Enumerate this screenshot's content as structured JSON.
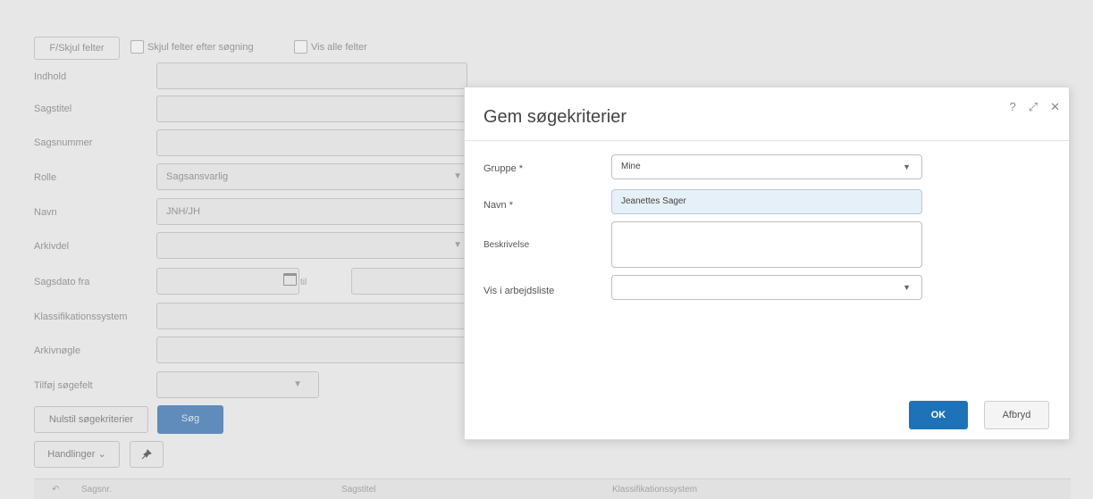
{
  "toolbar": {
    "hide_fields_button": "F/Skjul felter",
    "hide_after_search_label": "Skjul felter efter søgning",
    "show_all_label": "Vis alle felter"
  },
  "form": {
    "rows": [
      {
        "label": "Indhold",
        "value": ""
      },
      {
        "label": "Sagstitel",
        "value": ""
      },
      {
        "label": "Sagsnummer",
        "value": ""
      },
      {
        "label": "Rolle",
        "value": "Sagsansvarlig"
      },
      {
        "label": "Navn",
        "value": "JNH/JH"
      },
      {
        "label": "Arkivdel",
        "value": ""
      },
      {
        "label": "Sagsdato fra",
        "value": ""
      },
      {
        "label": "Klassifikationssystem",
        "value": ""
      },
      {
        "label": "Arkivnøgle",
        "value": ""
      },
      {
        "label": "Tilføj søgefelt",
        "value": ""
      }
    ],
    "date_to_label": "til",
    "reset_button": "Nulstil søgekriterier",
    "search_button": "Søg",
    "actions_button": "Handlinger",
    "actions_caret": "⌄"
  },
  "table": {
    "columns": [
      "Sagsnr.",
      "Sagstitel",
      "Klassifikationssystem"
    ]
  },
  "dialog": {
    "title": "Gem søgekriterier",
    "icons": {
      "help": "?",
      "expand": "⤢",
      "close": "✕"
    },
    "fields": {
      "group_label": "Gruppe *",
      "group_value": "Mine",
      "name_label": "Navn *",
      "name_value": "Jeanettes Sager",
      "description_label": "Beskrivelse",
      "description_value": "",
      "worklist_label": "Vis i arbejdsliste",
      "worklist_value": ""
    },
    "ok_button": "OK",
    "cancel_button": "Afbryd"
  },
  "colors": {
    "primary": "#1e73b8",
    "focus_field": "#e6f0f8"
  }
}
